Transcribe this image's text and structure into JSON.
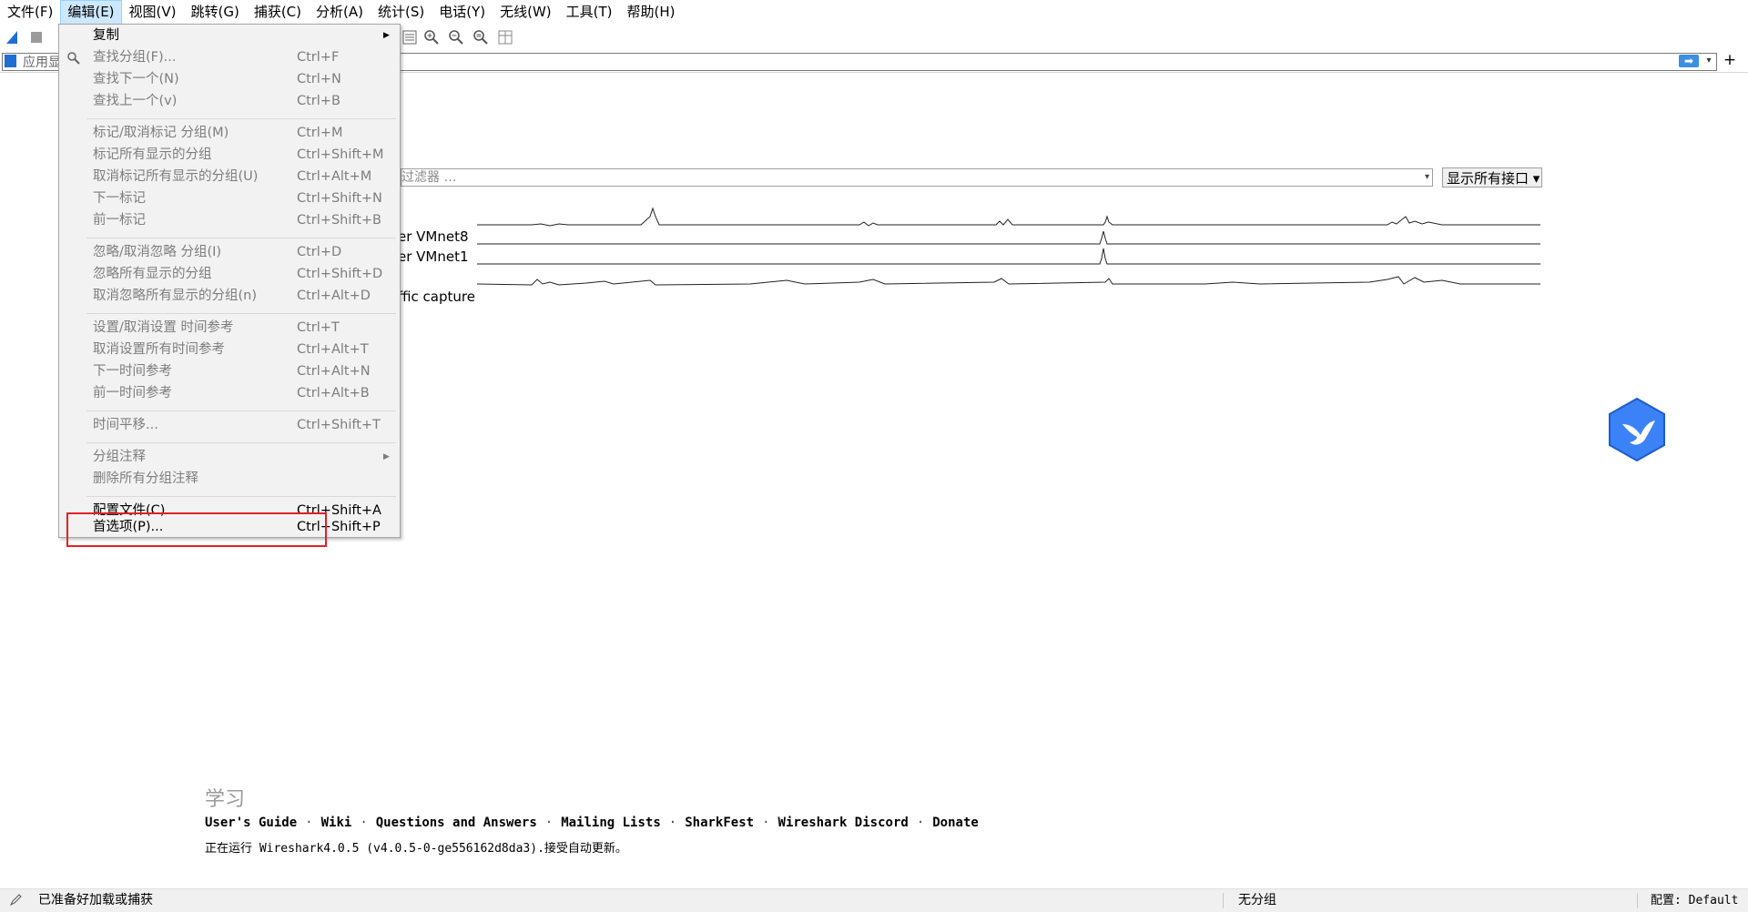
{
  "menubar": {
    "items": [
      "文件(F)",
      "编辑(E)",
      "视图(V)",
      "跳转(G)",
      "捕获(C)",
      "分析(A)",
      "统计(S)",
      "电话(Y)",
      "无线(W)",
      "工具(T)",
      "帮助(H)"
    ],
    "active_index": 1
  },
  "filter": {
    "placeholder": "应用显",
    "apply_icon": "arrow-right-icon",
    "add_label": "+"
  },
  "edit_menu": {
    "copy": "复制",
    "find_packet": {
      "label": "查找分组(F)...",
      "shortcut": "Ctrl+F"
    },
    "find_next": {
      "label": "查找下一个(N)",
      "shortcut": "Ctrl+N"
    },
    "find_prev": {
      "label": "查找上一个(v)",
      "shortcut": "Ctrl+B"
    },
    "mark_toggle": {
      "label": "标记/取消标记 分组(M)",
      "shortcut": "Ctrl+M"
    },
    "mark_all": {
      "label": "标记所有显示的分组",
      "shortcut": "Ctrl+Shift+M"
    },
    "unmark_all": {
      "label": "取消标记所有显示的分组(U)",
      "shortcut": "Ctrl+Alt+M"
    },
    "next_mark": {
      "label": "下一标记",
      "shortcut": "Ctrl+Shift+N"
    },
    "prev_mark": {
      "label": "前一标记",
      "shortcut": "Ctrl+Shift+B"
    },
    "ignore_toggle": {
      "label": "忽略/取消忽略 分组(I)",
      "shortcut": "Ctrl+D"
    },
    "ignore_all": {
      "label": "忽略所有显示的分组",
      "shortcut": "Ctrl+Shift+D"
    },
    "unignore_all": {
      "label": "取消忽略所有显示的分组(n)",
      "shortcut": "Ctrl+Alt+D"
    },
    "time_ref_toggle": {
      "label": "设置/取消设置 时间参考",
      "shortcut": "Ctrl+T"
    },
    "time_ref_clear": {
      "label": "取消设置所有时间参考",
      "shortcut": "Ctrl+Alt+T"
    },
    "time_ref_next": {
      "label": "下一时间参考",
      "shortcut": "Ctrl+Alt+N"
    },
    "time_ref_prev": {
      "label": "前一时间参考",
      "shortcut": "Ctrl+Alt+B"
    },
    "time_shift": {
      "label": "时间平移...",
      "shortcut": "Ctrl+Shift+T"
    },
    "packet_comment": "分组注释",
    "delete_comments": "删除所有分组注释",
    "profiles": {
      "label": "配置文件(C)...",
      "shortcut": "Ctrl+Shift+A"
    },
    "preferences": {
      "label": "首选项(P)...",
      "shortcut": "Ctrl+Shift+P"
    }
  },
  "welcome": {
    "capture_filter_placeholder": "过滤器 …",
    "show_all_interfaces": "显示所有接口",
    "interfaces": [
      {
        "label": "er VMnet8"
      },
      {
        "label": "er VMnet1"
      },
      {
        "label": ""
      },
      {
        "label": "ffic capture"
      }
    ]
  },
  "learn": {
    "heading": "学习",
    "links": [
      "User's Guide",
      "Wiki",
      "Questions and Answers",
      "Mailing Lists",
      "SharkFest",
      "Wireshark Discord",
      "Donate"
    ],
    "version": "正在运行 Wireshark4.0.5 (v4.0.5-0-ge556162d8da3).接受自动更新。"
  },
  "status": {
    "main": "已准备好加载或捕获",
    "packets": "无分组",
    "profile": "配置: Default"
  },
  "colors": {
    "accent": "#1f6fd1",
    "highlight_box": "#e0202a",
    "menu_active": "#cce8ff"
  }
}
